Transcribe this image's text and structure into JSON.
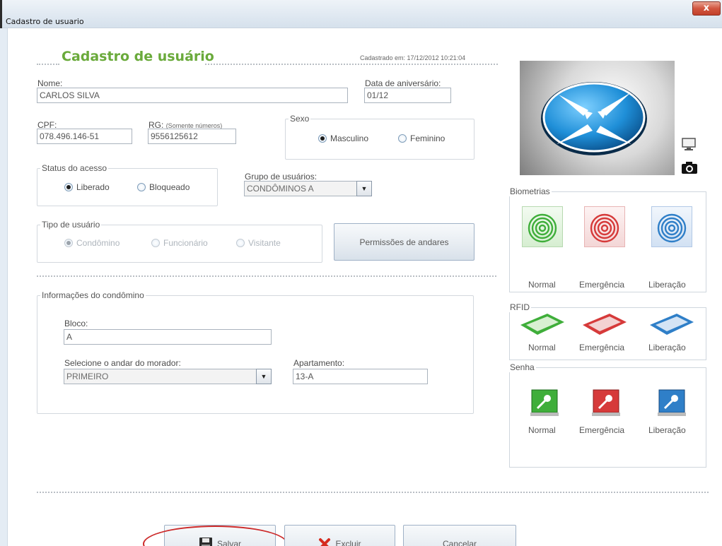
{
  "window": {
    "title": "Cadastro de usuario",
    "close": "x"
  },
  "header": {
    "title": "Cadastro de usuário",
    "created_label": "Cadastrado em: 17/12/2012 10:21:04"
  },
  "fields": {
    "nome_label": "Nome:",
    "nome_value": "CARLOS SILVA",
    "aniversario_label": "Data de aniversário:",
    "aniversario_value": "01/12",
    "cpf_label": "CPF:",
    "cpf_value": "078.496.146-51",
    "rg_label": "RG:",
    "rg_hint": "(Somente números)",
    "rg_value": "9556125612"
  },
  "sexo": {
    "legend": "Sexo",
    "options": [
      "Masculino",
      "Feminino"
    ],
    "selected": "Masculino"
  },
  "status": {
    "legend": "Status do acesso",
    "options": [
      "Liberado",
      "Bloqueado"
    ],
    "selected": "Liberado"
  },
  "grupo": {
    "label": "Grupo de usuários:",
    "value": "CONDÔMINOS A"
  },
  "tipo": {
    "legend": "Tipo de usuário",
    "options": [
      "Condômino",
      "Funcionário",
      "Visitante"
    ],
    "selected": "Condômino"
  },
  "permissoes_button": "Permissões de andares",
  "condominio": {
    "legend": "Informações do condômino",
    "bloco_label": "Bloco:",
    "bloco_value": "A",
    "andar_label": "Selecione o andar do morador:",
    "andar_value": "PRIMEIRO",
    "apto_label": "Apartamento:",
    "apto_value": "13-A"
  },
  "side": {
    "biometrias": {
      "legend": "Biometrias",
      "items": [
        "Normal",
        "Emergência",
        "Liberação"
      ]
    },
    "rfid": {
      "legend": "RFID",
      "items": [
        "Normal",
        "Emergência",
        "Liberação"
      ]
    },
    "senha": {
      "legend": "Senha",
      "items": [
        "Normal",
        "Emergência",
        "Liberação"
      ]
    }
  },
  "buttons": {
    "salvar": "Salvar",
    "excluir": "Excluir",
    "cancelar": "Cancelar"
  },
  "colors": {
    "green_title": "#6aaa3b",
    "normal": "#3fae3a",
    "emergencia": "#d63a3a",
    "liberacao": "#2f7fc8",
    "highlight": "#cc2a2a"
  }
}
